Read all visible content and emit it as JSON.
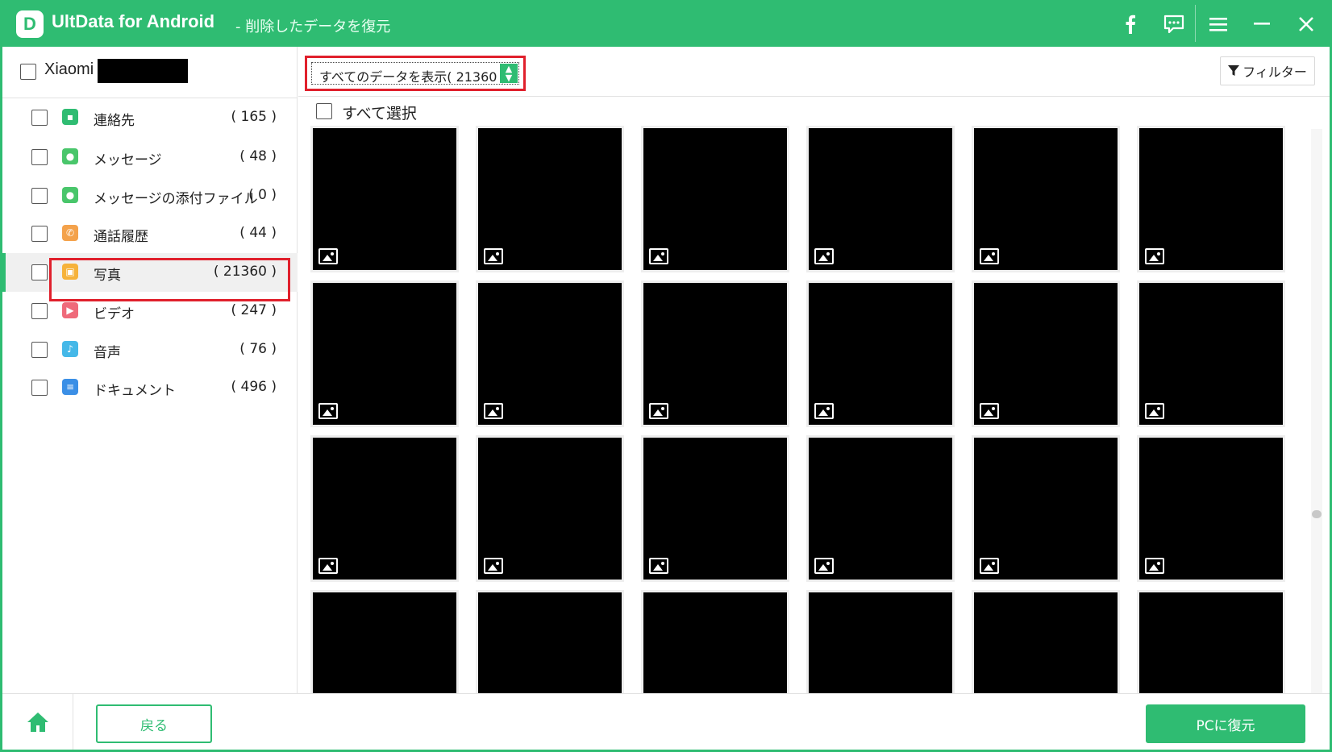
{
  "window": {
    "app_name": "UltData for Android",
    "subtitle": "- 削除したデータを復元",
    "logo_letter": "D",
    "accent_color": "#2fbc72",
    "highlight_color": "#e0202c"
  },
  "titlebar_icons": [
    "facebook-icon",
    "feedback-icon",
    "menu-icon",
    "minimize-icon",
    "close-icon"
  ],
  "device": {
    "name": "Xiaomi"
  },
  "categories": [
    {
      "label": "連絡先",
      "count": "( 165 )",
      "icon": "contacts-icon",
      "color": "#2fbc72"
    },
    {
      "label": "メッセージ",
      "count": "( 48 )",
      "icon": "message-icon",
      "color": "#49c66b"
    },
    {
      "label": "メッセージの添付ファイル",
      "count": "( 0 )",
      "icon": "attachment-icon",
      "color": "#49c66b"
    },
    {
      "label": "通話履歴",
      "count": "( 44 )",
      "icon": "call-log-icon",
      "color": "#f4a24b"
    },
    {
      "label": "写真",
      "count": "( 21360 )",
      "icon": "photo-icon",
      "color": "#f6b23a"
    },
    {
      "label": "ビデオ",
      "count": "( 247 )",
      "icon": "video-icon",
      "color": "#ef6a7a"
    },
    {
      "label": "音声",
      "count": "( 76 )",
      "icon": "audio-icon",
      "color": "#45b8e8"
    },
    {
      "label": "ドキュメント",
      "count": "( 496 )",
      "icon": "document-icon",
      "color": "#3b8fe6"
    }
  ],
  "active_category": "写真",
  "toolbar": {
    "view_select": "すべてのデータを表示( 21360 )",
    "filter_label": "フィルター"
  },
  "select_all_label": "すべて選択",
  "photos": {
    "visible_thumbnails": 24,
    "thumbnail_icon": "image-icon"
  },
  "footer": {
    "back_label": "戻る",
    "recover_label": "PCに復元"
  }
}
